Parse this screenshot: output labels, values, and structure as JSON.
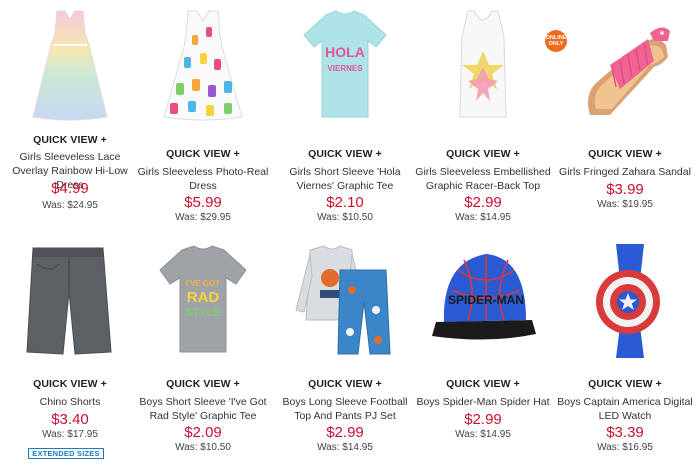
{
  "quick_view_label": "QUICK VIEW +",
  "products_row1": [
    {
      "name": "Girls Sleeveless Lace Overlay Rainbow Hi-Low Dress",
      "price": "$4.99",
      "was": "Was: $24.95",
      "image": "rainbow-dress-image"
    },
    {
      "name": "Girls Sleeveless Photo-Real Dress",
      "price": "$5.99",
      "was": "Was: $29.95",
      "image": "popsicle-dress-image"
    },
    {
      "name": "Girls Short Sleeve 'Hola Viernes' Graphic Tee",
      "price": "$2.10",
      "was": "Was: $10.50",
      "image": "hola-tee-image"
    },
    {
      "name": "Girls Sleeveless Embellished Graphic Racer-Back Top",
      "price": "$2.99",
      "was": "Was: $14.95",
      "image": "star-top-image"
    },
    {
      "name": "Girls Fringed Zahara Sandal",
      "price": "$3.99",
      "was": "Was: $19.95",
      "image": "pink-sandal-image"
    }
  ],
  "products_row2": [
    {
      "name": "Chino Shorts",
      "price": "$3.40",
      "was": "Was: $17.95",
      "image": "chino-shorts-image"
    },
    {
      "name": "Boys Short Sleeve 'I've Got Rad Style' Graphic Tee",
      "price": "$2.09",
      "was": "Was: $10.50",
      "image": "rad-style-tee-image"
    },
    {
      "name": "Boys Long Sleeve Football Top And Pants PJ Set",
      "price": "$2.99",
      "was": "Was: $14.95",
      "image": "football-pj-image"
    },
    {
      "name": "Boys Spider-Man Spider Hat",
      "price": "$2.99",
      "was": "Was: $14.95",
      "image": "spiderman-hat-image"
    },
    {
      "name": "Boys Captain America Digital LED Watch",
      "price": "$3.39",
      "was": "Was: $16.95",
      "image": "captain-america-watch-image"
    }
  ],
  "badges": {
    "online_only_line1": "ONLINE",
    "online_only_line2": "ONLY",
    "extended_sizes": "EXTENDED SIZES"
  },
  "image_texts": {
    "hola": "HOLA",
    "viernes": "VIERNES",
    "ive_got": "I'VE GOT",
    "rad": "RAD",
    "style": "STYLE",
    "spider_man": "SPIDER-MAN"
  },
  "colors": {
    "price_red": "#c8102e",
    "badge_orange": "#f26b1d",
    "extended_blue": "#1e7bc0",
    "sandal_pink": "#f06292"
  }
}
